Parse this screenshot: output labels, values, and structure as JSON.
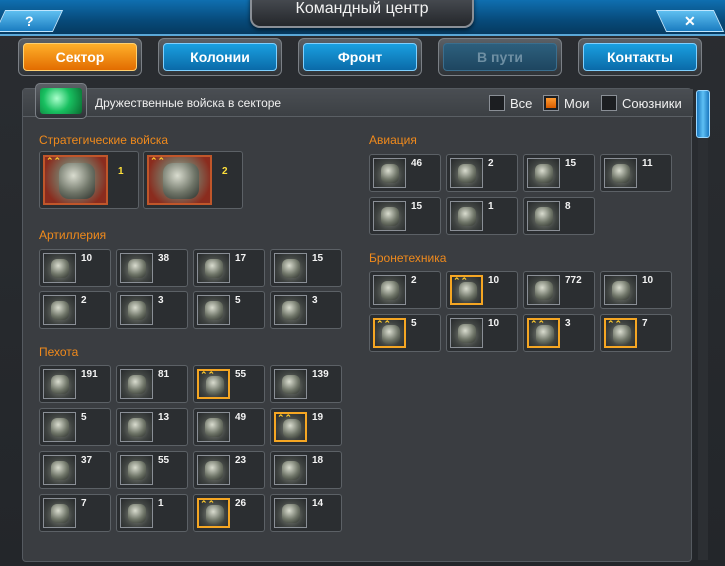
{
  "window": {
    "title": "Командный центр",
    "help_label": "?",
    "close_label": "✕"
  },
  "tabs": [
    {
      "label": "Сектор",
      "state": "active"
    },
    {
      "label": "Колонии",
      "state": "normal"
    },
    {
      "label": "Фронт",
      "state": "normal"
    },
    {
      "label": "В пути",
      "state": "disabled"
    },
    {
      "label": "Контакты",
      "state": "normal"
    }
  ],
  "filter": {
    "title": "Дружественные войска в секторе",
    "options": [
      {
        "label": "Все",
        "checked": false
      },
      {
        "label": "Мои",
        "checked": true
      },
      {
        "label": "Союзники",
        "checked": false
      }
    ]
  },
  "sections": {
    "strategic": {
      "title": "Стратегические войска",
      "units": [
        {
          "count": "1",
          "ranked": true
        },
        {
          "count": "2",
          "ranked": true
        }
      ]
    },
    "artillery": {
      "title": "Артиллерия",
      "units": [
        {
          "count": "10",
          "ranked": false
        },
        {
          "count": "38",
          "ranked": false
        },
        {
          "count": "17",
          "ranked": false
        },
        {
          "count": "15",
          "ranked": false
        },
        {
          "count": "2",
          "ranked": false
        },
        {
          "count": "3",
          "ranked": false
        },
        {
          "count": "5",
          "ranked": false
        },
        {
          "count": "3",
          "ranked": false
        }
      ]
    },
    "infantry": {
      "title": "Пехота",
      "units": [
        {
          "count": "191",
          "ranked": false
        },
        {
          "count": "81",
          "ranked": false
        },
        {
          "count": "55",
          "ranked": true
        },
        {
          "count": "139",
          "ranked": false
        },
        {
          "count": "5",
          "ranked": false
        },
        {
          "count": "13",
          "ranked": false
        },
        {
          "count": "49",
          "ranked": false
        },
        {
          "count": "19",
          "ranked": true
        },
        {
          "count": "37",
          "ranked": false
        },
        {
          "count": "55",
          "ranked": false
        },
        {
          "count": "23",
          "ranked": false
        },
        {
          "count": "18",
          "ranked": false
        },
        {
          "count": "7",
          "ranked": false
        },
        {
          "count": "1",
          "ranked": false
        },
        {
          "count": "26",
          "ranked": true
        },
        {
          "count": "14",
          "ranked": false
        }
      ]
    },
    "aviation": {
      "title": "Авиация",
      "units": [
        {
          "count": "46",
          "ranked": false
        },
        {
          "count": "2",
          "ranked": false
        },
        {
          "count": "15",
          "ranked": false
        },
        {
          "count": "11",
          "ranked": false
        },
        {
          "count": "15",
          "ranked": false
        },
        {
          "count": "1",
          "ranked": false
        },
        {
          "count": "8",
          "ranked": false
        }
      ]
    },
    "armor": {
      "title": "Бронетехника",
      "units": [
        {
          "count": "2",
          "ranked": false
        },
        {
          "count": "10",
          "ranked": true
        },
        {
          "count": "772",
          "ranked": false
        },
        {
          "count": "10",
          "ranked": false
        },
        {
          "count": "5",
          "ranked": true
        },
        {
          "count": "10",
          "ranked": false
        },
        {
          "count": "3",
          "ranked": true
        },
        {
          "count": "7",
          "ranked": true
        }
      ]
    }
  },
  "rank_glyph": "⌃⌃",
  "colors": {
    "accent_orange": "#f08a1c",
    "tab_blue": "#1aa0e0",
    "tab_active": "#ffb02a",
    "rank_gold": "#f5a623"
  }
}
